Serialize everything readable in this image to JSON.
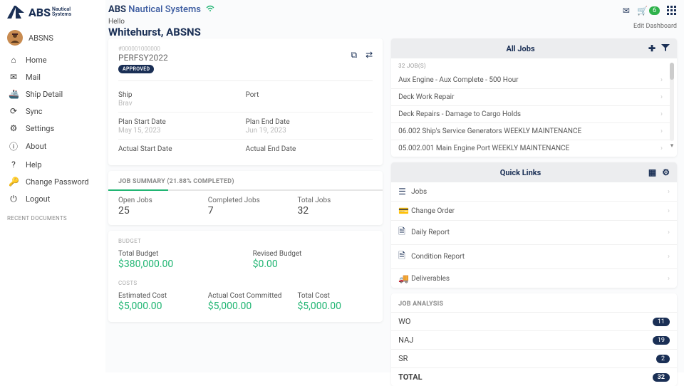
{
  "brand": {
    "line1": "ABS",
    "line2a": "Nautical",
    "line2b": "Systems"
  },
  "top": {
    "brand1": "ABS",
    "brand2": "Nautical Systems",
    "hello": "Hello",
    "user": "Whitehurst, ABSNS",
    "cart_count": "6",
    "edit_dashboard": "Edit Dashboard"
  },
  "avatar_name": "ABSNS",
  "nav": {
    "home": "Home",
    "mail": "Mail",
    "ship": "Ship Detail",
    "sync": "Sync",
    "settings": "Settings",
    "about": "About",
    "help": "Help",
    "chpw": "Change Password",
    "logout": "Logout"
  },
  "recent_docs": "RECENT DOCUMENTS",
  "plan": {
    "id": "#000001000000",
    "name": "PERFSY2022",
    "status": "APPROVED",
    "ship_label": "Ship",
    "ship_val": "Brav",
    "port_label": "Port",
    "port_val": "",
    "psd_label": "Plan Start Date",
    "psd_val": "May 15, 2023",
    "ped_label": "Plan End Date",
    "ped_val": "Jun 19, 2023",
    "asd_label": "Actual Start Date",
    "asd_val": "",
    "aed_label": "Actual End Date",
    "aed_val": ""
  },
  "summary": {
    "title": "JOB SUMMARY (21.88% COMPLETED)",
    "open_label": "Open Jobs",
    "open_val": "25",
    "comp_label": "Completed Jobs",
    "comp_val": "7",
    "total_label": "Total Jobs",
    "total_val": "32"
  },
  "budget": {
    "sec1": "BUDGET",
    "tb_label": "Total Budget",
    "tb_val": "$380,000.00",
    "rb_label": "Revised Budget",
    "rb_val": "$0.00",
    "sec2": "COSTS",
    "ec_label": "Estimated Cost",
    "ec_val": "$5,000.00",
    "ac_label": "Actual Cost Committed",
    "ac_val": "$5,000.00",
    "tc_label": "Total Cost",
    "tc_val": "$5,000.00"
  },
  "alljobs": {
    "title": "All Jobs",
    "count": "32 JOB(S)",
    "items": [
      "Aux Engine - Aux Complete - 500 Hour",
      "Deck Work Repair",
      "Deck Repairs - Damage to Cargo Holds",
      "06.002 Ship's Service Generators WEEKLY MAINTENANCE",
      "05.002.001 Main Engine Port WEEKLY MAINTENANCE"
    ]
  },
  "quicklinks": {
    "title": "Quick Links",
    "items": {
      "jobs": "Jobs",
      "change_order": "Change Order",
      "daily_report": "Daily Report",
      "condition_report": "Condition Report",
      "deliverables": "Deliverables"
    }
  },
  "job_analysis": {
    "title": "JOB ANALYSIS",
    "wo_label": "WO",
    "wo_val": "11",
    "naj_label": "NAJ",
    "naj_val": "19",
    "sr_label": "SR",
    "sr_val": "2",
    "total_label": "TOTAL",
    "total_val": "32"
  }
}
